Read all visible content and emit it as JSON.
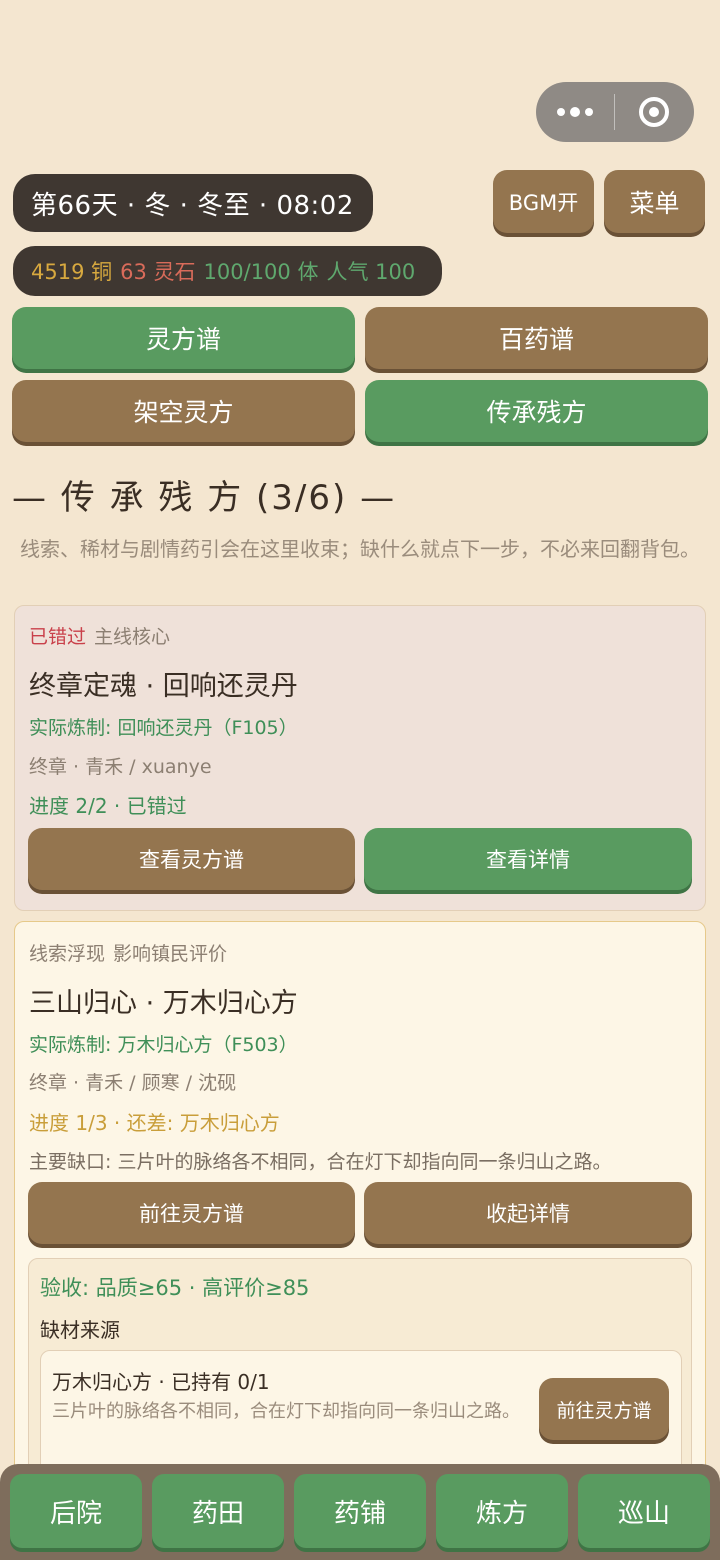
{
  "capsule": {
    "more_icon": "more-dots-icon",
    "close_icon": "target-icon"
  },
  "status": {
    "text": "第66天 · 冬 · 冬至 · 08:02"
  },
  "stats": {
    "copper": "4519 铜",
    "spirit_stones": "63 灵石",
    "stamina": "100/100 体",
    "popularity": "人气 100"
  },
  "header_buttons": {
    "bgm": "BGM开",
    "menu": "菜单"
  },
  "tabs": [
    {
      "label": "灵方谱",
      "active": true
    },
    {
      "label": "百药谱",
      "active": false
    },
    {
      "label": "架空灵方",
      "active": false
    },
    {
      "label": "传承残方",
      "active": true
    }
  ],
  "section": {
    "title": "— 传 承 残 方 (3/6) —",
    "hint": "线索、稀材与剧情药引会在这里收束；缺什么就点下一步，不必来回翻背包。"
  },
  "cards": [
    {
      "status_tag": "已错过",
      "category": "主线核心",
      "title": "终章定魂 · 回响还灵丹",
      "actual": "实际炼制: 回响还灵丹（F105）",
      "characters": "终章 · 青禾 / xuanye",
      "progress": "进度 2/2 · 已错过",
      "btn_left": "查看灵方谱",
      "btn_right": "查看详情"
    },
    {
      "status_tag": "线索浮现",
      "category": "影响镇民评价",
      "title": "三山归心 · 万木归心方",
      "actual": "实际炼制: 万木归心方（F503）",
      "characters": "终章 · 青禾 / 顾寒 / 沈砚",
      "progress": "进度 1/3 · 还差: 万木归心方",
      "gap": "主要缺口: 三片叶的脉络各不相同，合在灯下却指向同一条归山之路。",
      "btn_left": "前往灵方谱",
      "btn_right": "收起详情",
      "acceptance": "验收: 品质≥65 · 高评价≥85",
      "source_label": "缺材来源",
      "source": {
        "title": "万木归心方 · 已持有 0/1",
        "desc": "三片叶的脉络各不相同，合在灯下却指向同一条归山之路。",
        "button": "前往灵方谱"
      }
    }
  ],
  "bottom_nav": [
    "后院",
    "药田",
    "药铺",
    "炼方",
    "巡山"
  ]
}
